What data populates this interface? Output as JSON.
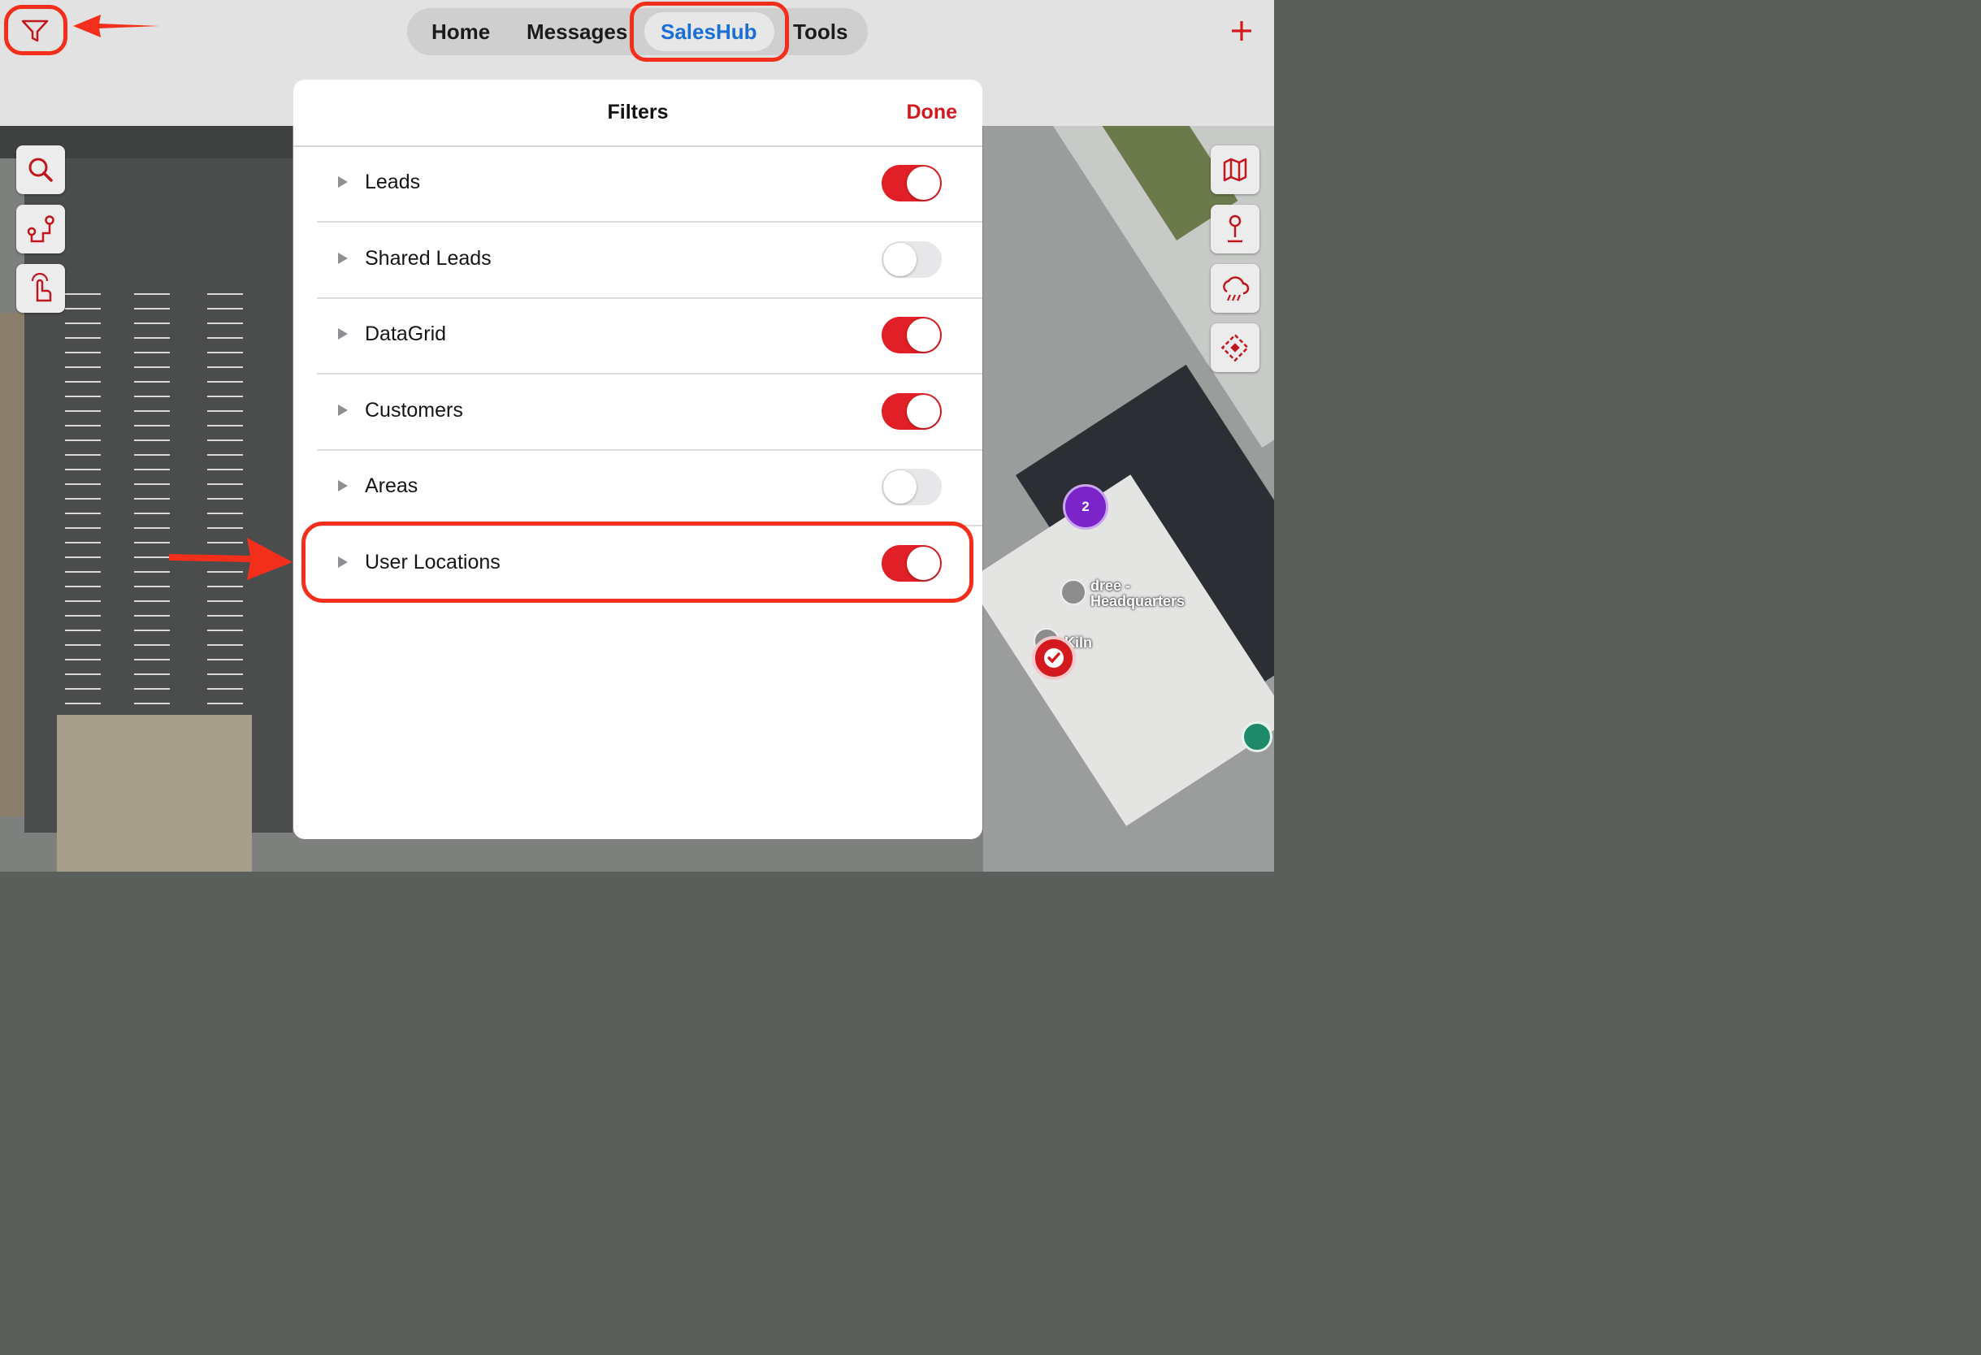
{
  "nav": {
    "tabs": [
      {
        "label": "Home"
      },
      {
        "label": "Messages"
      },
      {
        "label": "SalesHub"
      },
      {
        "label": "Tools"
      }
    ],
    "active_tab": "SalesHub",
    "add_icon": "plus-icon",
    "filter_icon": "filter-funnel-icon"
  },
  "map_tools": {
    "left": [
      "search-icon",
      "route-icon",
      "tap-hand-icon"
    ],
    "right": [
      "map-layers-icon",
      "location-pin-icon",
      "weather-cloud-icon",
      "compass-diamond-icon"
    ]
  },
  "filters": {
    "title": "Filters",
    "done_label": "Done",
    "items": [
      {
        "label": "Leads",
        "enabled": true
      },
      {
        "label": "Shared Leads",
        "enabled": false
      },
      {
        "label": "DataGrid",
        "enabled": true
      },
      {
        "label": "Customers",
        "enabled": true
      },
      {
        "label": "Areas",
        "enabled": false
      },
      {
        "label": "User Locations",
        "enabled": true
      }
    ]
  },
  "map": {
    "cluster_count": "2",
    "place_label_1": "dree -",
    "place_label_2": "Headquarters",
    "place_label_3": "Kiln"
  },
  "colors": {
    "accent_red": "#d3181e",
    "active_tab_blue": "#1a6fd6",
    "annotation_red": "#f32f1b",
    "cluster_purple": "#7b24c9"
  }
}
